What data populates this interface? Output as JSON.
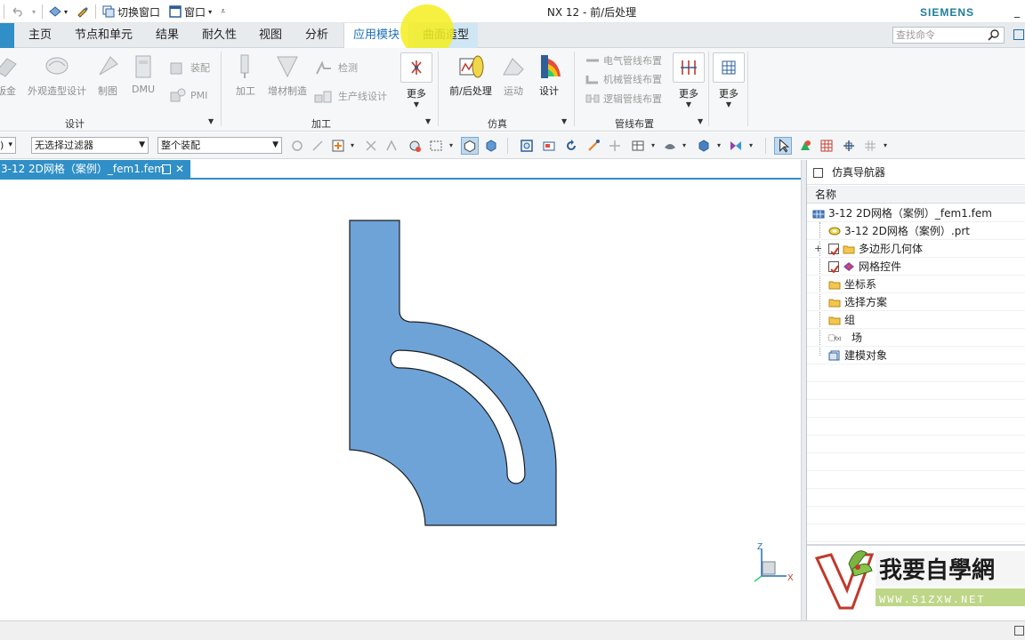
{
  "window": {
    "title": "NX 12 - 前/后处理",
    "brand": "SIEMENS"
  },
  "quick_access": {
    "switch_window_label": "切换窗口",
    "window_label": "窗口"
  },
  "tabs": [
    {
      "label": "主页"
    },
    {
      "label": "节点和单元"
    },
    {
      "label": "结果"
    },
    {
      "label": "耐久性"
    },
    {
      "label": "视图"
    },
    {
      "label": "分析"
    },
    {
      "label": "应用模块",
      "active": true
    },
    {
      "label": "曲面造型",
      "hover": true
    }
  ],
  "search": {
    "placeholder": "查找命令"
  },
  "ribbon": {
    "design_group": {
      "label": "设计",
      "items": [
        "钣金",
        "外观造型设计",
        "制图",
        "DMU",
        "装配",
        "PMI"
      ]
    },
    "manufacturing_group": {
      "label": "加工",
      "items": [
        "加工",
        "增材制造",
        "检测",
        "生产线设计"
      ]
    },
    "more_1": "更多",
    "simulation_group": {
      "label": "仿真",
      "items": [
        "前/后处理",
        "运动",
        "设计"
      ]
    },
    "routing_group": {
      "label": "管线布置",
      "items": [
        "电气管线布置",
        "机械管线布置",
        "逻辑管线布置"
      ]
    },
    "more_2": "更多",
    "more_3": "更多"
  },
  "toolbar": {
    "filter_value": "无选择过滤器",
    "scope_value": "整个装配"
  },
  "document_tab": {
    "label": "3-12 2D网格（案例）_fem1.fem"
  },
  "triad": {
    "z": "Z",
    "x": "X"
  },
  "navigator": {
    "title": "仿真导航器",
    "column_name": "名称",
    "items": [
      {
        "label": "3-12 2D网格（案例）_fem1.fem",
        "level": 0
      },
      {
        "label": "3-12 2D网格（案例）.prt",
        "level": 1
      },
      {
        "label": "多边形几何体",
        "level": 1,
        "checked": true,
        "expandable": true
      },
      {
        "label": "网格控件",
        "level": 1,
        "checked": true
      },
      {
        "label": "坐标系",
        "level": 1
      },
      {
        "label": "选择方案",
        "level": 1
      },
      {
        "label": "组",
        "level": 1
      },
      {
        "label": "场",
        "level": 1
      },
      {
        "label": "建模对象",
        "level": 1
      }
    ]
  },
  "watermark": {
    "text_main": "我要自學網",
    "text_url": "WWW.51ZXW.NET"
  },
  "colors": {
    "accent": "#2f8fc6",
    "part_fill": "#6ea3d8",
    "brand": "#1f7d97"
  }
}
